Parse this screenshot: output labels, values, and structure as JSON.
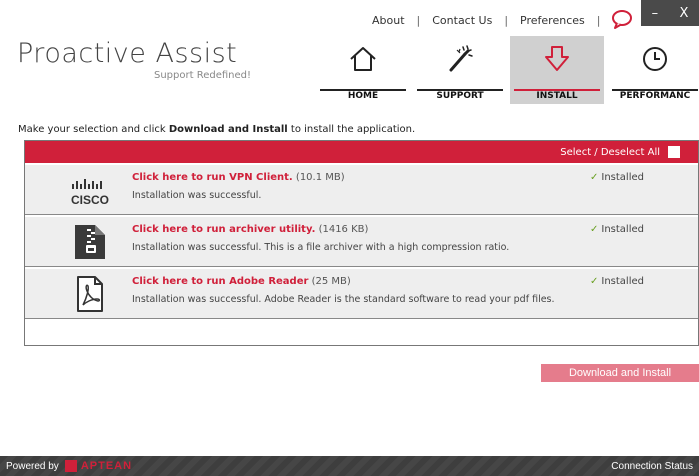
{
  "top_links": {
    "about": "About",
    "contact": "Contact Us",
    "preferences": "Preferences",
    "separator": "|"
  },
  "window": {
    "minimize": "–",
    "close": "X"
  },
  "brand": {
    "title": "Proactive Assist",
    "subtitle": "Support Redefined!"
  },
  "nav": [
    {
      "label": "HOME",
      "icon": "home-icon",
      "active": false
    },
    {
      "label": "SUPPORT",
      "icon": "magic-wand-icon",
      "active": false
    },
    {
      "label": "INSTALL",
      "icon": "download-arrow-icon",
      "active": true
    },
    {
      "label": "PERFORMANC",
      "icon": "clock-icon",
      "active": false
    }
  ],
  "instruction": {
    "before": "Make your selection and click ",
    "bold": "Download and Install",
    "after": " to install the application."
  },
  "panel": {
    "select_all": "Select / Deselect All"
  },
  "apps": [
    {
      "logo": "cisco-logo",
      "logo_text": "CISCO",
      "link": "Click here to run VPN Client.",
      "size": "(10.1 MB)",
      "desc": "Installation was successful.",
      "status": "Installed"
    },
    {
      "logo": "zip-archive-icon",
      "link": "Click here to run archiver utility.",
      "size": "(1416 KB)",
      "desc": "Installation was successful. This is a file archiver with a high compression ratio.",
      "status": "Installed"
    },
    {
      "logo": "pdf-document-icon",
      "link": "Click here to run Adobe Reader",
      "size": "(25 MB)",
      "desc": "Installation was successful. Adobe Reader is the standard software to read your pdf files.",
      "status": "Installed"
    }
  ],
  "download_button": "Download and Install",
  "footer": {
    "powered": "Powered by",
    "vendor": "APTEAN",
    "connection": "Connection Status"
  },
  "colors": {
    "accent": "#d0203a",
    "success": "#6aa023",
    "button": "#e57c8c"
  }
}
